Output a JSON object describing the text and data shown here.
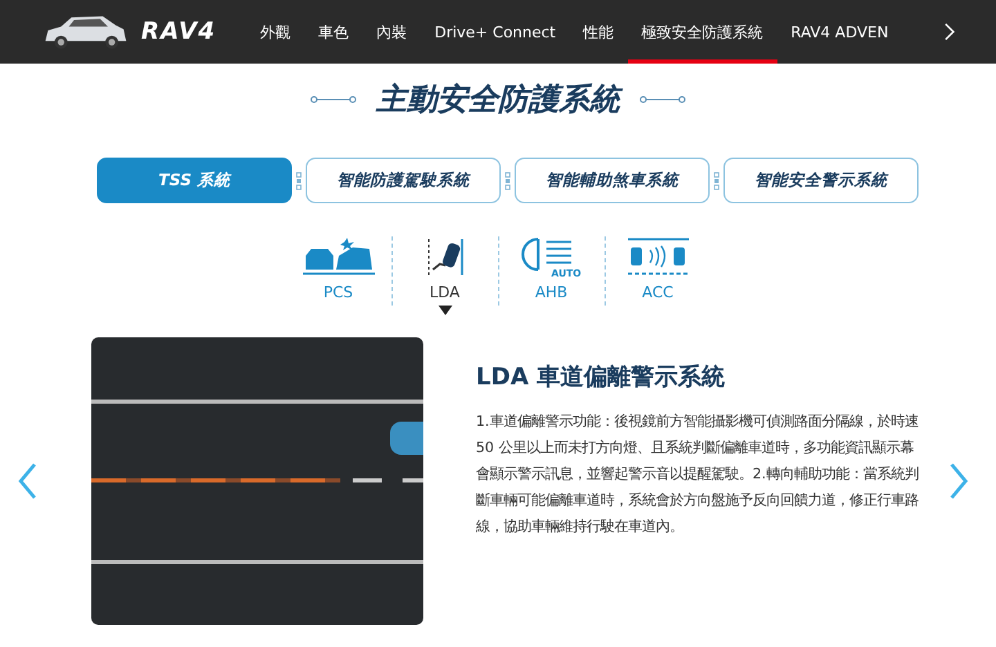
{
  "nav": {
    "brand": "RAV4",
    "items": [
      {
        "label": "外觀",
        "selected": false
      },
      {
        "label": "車色",
        "selected": false
      },
      {
        "label": "內裝",
        "selected": false
      },
      {
        "label": "Drive+ Connect",
        "selected": false
      },
      {
        "label": "性能",
        "selected": false
      },
      {
        "label": "極致安全防護系統",
        "selected": true
      },
      {
        "label": "RAV4 ADVEN",
        "selected": false
      }
    ]
  },
  "heading": "主動安全防護系統",
  "tabs": [
    {
      "label": "TSS 系統",
      "selected": true
    },
    {
      "label": "智能防護駕駛系統",
      "selected": false
    },
    {
      "label": "智能輔助煞車系統",
      "selected": false
    },
    {
      "label": "智能安全警示系統",
      "selected": false
    }
  ],
  "features": [
    {
      "kind": "pcs",
      "label": "PCS",
      "selected": false
    },
    {
      "kind": "lda",
      "label": "LDA",
      "selected": true
    },
    {
      "kind": "ahb",
      "label": "AHB",
      "badge": "AUTO",
      "selected": false
    },
    {
      "kind": "acc",
      "label": "ACC",
      "selected": false
    }
  ],
  "detail": {
    "title": "LDA 車道偏離警示系統",
    "body": "1.車道偏離警示功能：後視鏡前方智能攝影機可偵測路面分隔線，於時速 50 公里以上而未打方向燈、且系統判斷偏離車道時，多功能資訊顯示幕會顯示警示訊息，並響起警示音以提醒駕駛。2.轉向輔助功能：當系統判斷車輛可能偏離車道時，系統會於方向盤施予反向回饋力道，修正行車路線，協助車輛維持行駛在車道內。"
  }
}
